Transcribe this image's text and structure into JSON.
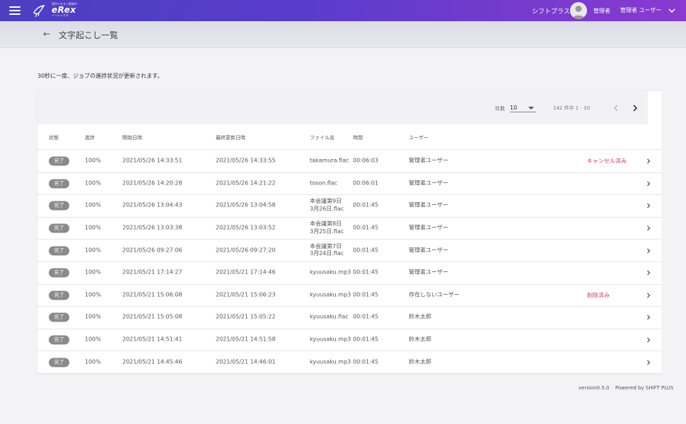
{
  "header": {
    "logo_tag": "音声テキスト変換AI",
    "logo_name": "eRex",
    "logo_sub": "イーレックス",
    "org": "シフトプラス",
    "role": "管理者",
    "user_name": "管理者 ユーザー"
  },
  "page": {
    "back_icon": "←",
    "title": "文字起こし一覧",
    "notice": "30秒に一度、ジョブの進捗状況が更新されます。"
  },
  "pager": {
    "per_page_label": "件数",
    "per_page_value": "10",
    "range_text": "142 件中 1 - 10"
  },
  "table": {
    "headers": {
      "status": "状態",
      "progress": "進捗",
      "start": "開始日時",
      "updated": "最終更新日時",
      "file": "ファイル名",
      "duration": "時間",
      "user": "ユーザー"
    },
    "rows": [
      {
        "status": "完了",
        "progress": "100%",
        "start": "2021/05/26 14:33:51",
        "updated": "2021/05/26 14:33:55",
        "file": "takamura.flac",
        "duration": "00:06:03",
        "user": "管理者ユーザー",
        "note": "キャンセル済み"
      },
      {
        "status": "完了",
        "progress": "100%",
        "start": "2021/05/26 14:20:28",
        "updated": "2021/05/26 14:21:22",
        "file": "toson.flac",
        "duration": "00:06:01",
        "user": "管理者ユーザー",
        "note": ""
      },
      {
        "status": "完了",
        "progress": "100%",
        "start": "2021/05/26 13:04:43",
        "updated": "2021/05/26 13:04:58",
        "file": "本会議第9日\n3月26日.flac",
        "duration": "00:01:45",
        "user": "管理者ユーザー",
        "note": ""
      },
      {
        "status": "完了",
        "progress": "100%",
        "start": "2021/05/26 13:03:38",
        "updated": "2021/05/26 13:03:52",
        "file": "本会議第8日\n3月25日.flac",
        "duration": "00:01:45",
        "user": "管理者ユーザー",
        "note": ""
      },
      {
        "status": "完了",
        "progress": "100%",
        "start": "2021/05/26 09:27:06",
        "updated": "2021/05/26 09:27:20",
        "file": "本会議第7日\n3月24日.flac",
        "duration": "00:01:45",
        "user": "管理者ユーザー",
        "note": ""
      },
      {
        "status": "完了",
        "progress": "100%",
        "start": "2021/05/21 17:14:27",
        "updated": "2021/05/21 17:14:46",
        "file": "kyuusaku.mp3",
        "duration": "00:01:45",
        "user": "管理者ユーザー",
        "note": ""
      },
      {
        "status": "完了",
        "progress": "100%",
        "start": "2021/05/21 15:06:08",
        "updated": "2021/05/21 15:06:23",
        "file": "kyuusaku.mp3",
        "duration": "00:01:45",
        "user": "存在しないユーザー",
        "note": "削除済み"
      },
      {
        "status": "完了",
        "progress": "100%",
        "start": "2021/05/21 15:05:08",
        "updated": "2021/05/21 15:05:22",
        "file": "kyuusaku.flac",
        "duration": "00:01:45",
        "user": "鈴木太郎",
        "note": ""
      },
      {
        "status": "完了",
        "progress": "100%",
        "start": "2021/05/21 14:51:41",
        "updated": "2021/05/21 14:51:58",
        "file": "kyuusaku.mp3",
        "duration": "00:01:45",
        "user": "鈴木太郎",
        "note": ""
      },
      {
        "status": "完了",
        "progress": "100%",
        "start": "2021/05/21 14:45:46",
        "updated": "2021/05/21 14:46:01",
        "file": "kyuusaku.mp3",
        "duration": "00:01:45",
        "user": "鈴木太郎",
        "note": ""
      }
    ]
  },
  "footer": {
    "version": "version0.5.0",
    "powered": "Powered by SHIFT PLUS"
  },
  "colors": {
    "header_start": "#4b3fc0",
    "header_end": "#8a3ad0",
    "badge": "#8a8a8a",
    "note": "#c83c6e"
  },
  "icons": {
    "menu": "hamburger-menu-icon",
    "logo": "bird-logo-icon",
    "avatar": "user-avatar-icon",
    "user_menu": "chevron-down-icon",
    "back": "arrow-left-icon",
    "prev": "chevron-left-icon",
    "next": "chevron-right-icon",
    "row": "chevron-right-icon"
  }
}
